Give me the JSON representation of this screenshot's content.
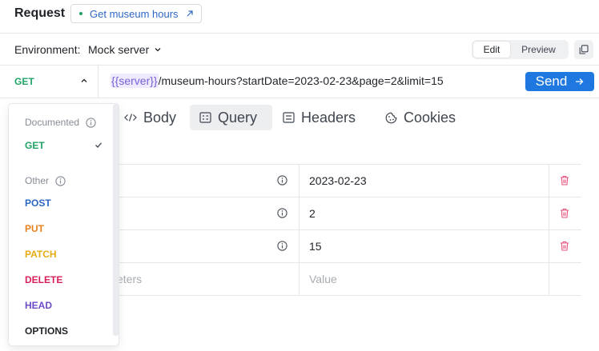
{
  "header": {
    "title": "Request",
    "link_label": "Get museum hours"
  },
  "environment": {
    "label": "Environment:",
    "value": "Mock server",
    "edit_label": "Edit",
    "preview_label": "Preview"
  },
  "request": {
    "method": "GET",
    "url_variable": "{{server}}",
    "url_path": "/museum-hours?startDate=2023-02-23&page=2&limit=15",
    "send_label": "Send"
  },
  "tabs": [
    {
      "label": "Body",
      "icon": "code-icon"
    },
    {
      "label": "Query",
      "icon": "query-icon"
    },
    {
      "label": "Headers",
      "icon": "list-icon"
    },
    {
      "label": "Cookies",
      "icon": "cookie-icon"
    }
  ],
  "query_params": {
    "rows": [
      {
        "value": "2023-02-23"
      },
      {
        "value": "2"
      },
      {
        "value": "15"
      }
    ],
    "new_row": {
      "key_placeholder_visible": "eters",
      "value_placeholder": "Value"
    }
  },
  "method_dropdown": {
    "documented_label": "Documented",
    "other_label": "Other",
    "documented_methods": [
      {
        "label": "GET",
        "color": "#21a366",
        "selected": true
      }
    ],
    "other_methods": [
      {
        "label": "POST",
        "color": "#2d66c3"
      },
      {
        "label": "PUT",
        "color": "#e8811a"
      },
      {
        "label": "PATCH",
        "color": "#e5ab14"
      },
      {
        "label": "DELETE",
        "color": "#d91f59"
      },
      {
        "label": "HEAD",
        "color": "#6c4bc8"
      },
      {
        "label": "OPTIONS",
        "color": "#1f2328"
      }
    ]
  },
  "colors": {
    "accent": "#1f78e0",
    "get": "#21a366",
    "delete_icon": "#e7547d"
  }
}
